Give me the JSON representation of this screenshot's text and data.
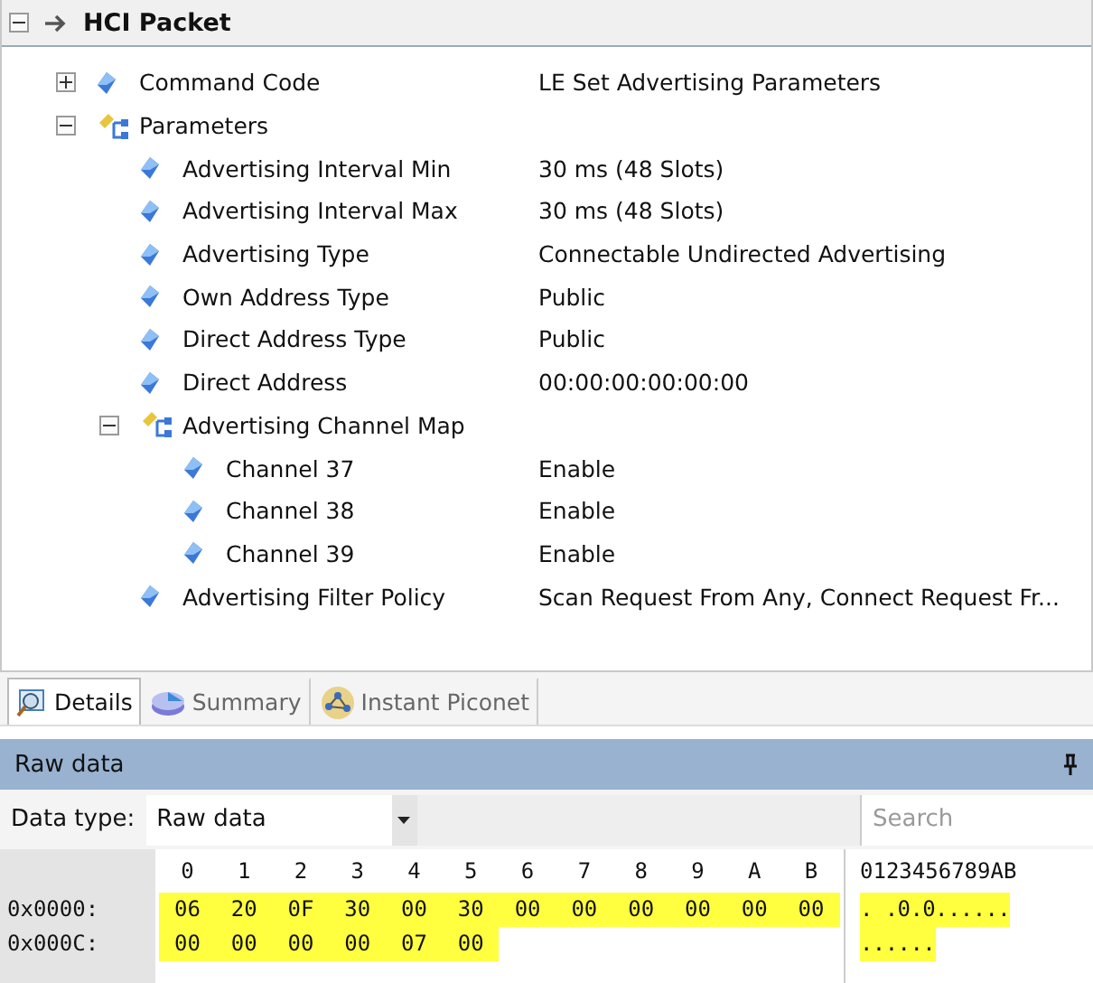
{
  "header": {
    "title": "HCI Packet",
    "expanded": true
  },
  "tree": [
    {
      "kind": "field",
      "label": "Command Code",
      "value": "LE Set Advertising Parameters",
      "expanded": false
    },
    {
      "kind": "group",
      "label": "Parameters",
      "expanded": true,
      "children": [
        {
          "kind": "field",
          "label": "Advertising Interval Min",
          "value": "30 ms (48 Slots)"
        },
        {
          "kind": "field",
          "label": "Advertising Interval Max",
          "value": "30 ms (48 Slots)"
        },
        {
          "kind": "field",
          "label": "Advertising Type",
          "value": "Connectable Undirected Advertising"
        },
        {
          "kind": "field",
          "label": "Own Address Type",
          "value": "Public"
        },
        {
          "kind": "field",
          "label": "Direct Address Type",
          "value": "Public"
        },
        {
          "kind": "field",
          "label": "Direct Address",
          "value": "00:00:00:00:00:00"
        },
        {
          "kind": "group",
          "label": "Advertising Channel Map",
          "expanded": true,
          "children": [
            {
              "kind": "field",
              "label": "Channel 37",
              "value": "Enable"
            },
            {
              "kind": "field",
              "label": "Channel 38",
              "value": "Enable"
            },
            {
              "kind": "field",
              "label": "Channel 39",
              "value": "Enable"
            }
          ]
        },
        {
          "kind": "field",
          "label": "Advertising Filter Policy",
          "value": "Scan Request From Any, Connect Request Fr..."
        }
      ]
    }
  ],
  "tabs": [
    {
      "label": "Details",
      "selected": true
    },
    {
      "label": "Summary",
      "selected": false
    },
    {
      "label": "Instant Piconet",
      "selected": false
    }
  ],
  "raw": {
    "title": "Raw data",
    "data_type_label": "Data type:",
    "data_type": "Raw data",
    "search_placeholder": "Search",
    "columns": [
      "0",
      "1",
      "2",
      "3",
      "4",
      "5",
      "6",
      "7",
      "8",
      "9",
      "A",
      "B"
    ],
    "ascii_header": "0123456789AB",
    "rows": [
      {
        "offset": "0x0000:",
        "bytes": [
          "06",
          "20",
          "0F",
          "30",
          "00",
          "30",
          "00",
          "00",
          "00",
          "00",
          "00",
          "00"
        ],
        "ascii": ". .0.0......"
      },
      {
        "offset": "0x000C:",
        "bytes": [
          "00",
          "00",
          "00",
          "00",
          "07",
          "00"
        ],
        "ascii": "......"
      }
    ]
  }
}
